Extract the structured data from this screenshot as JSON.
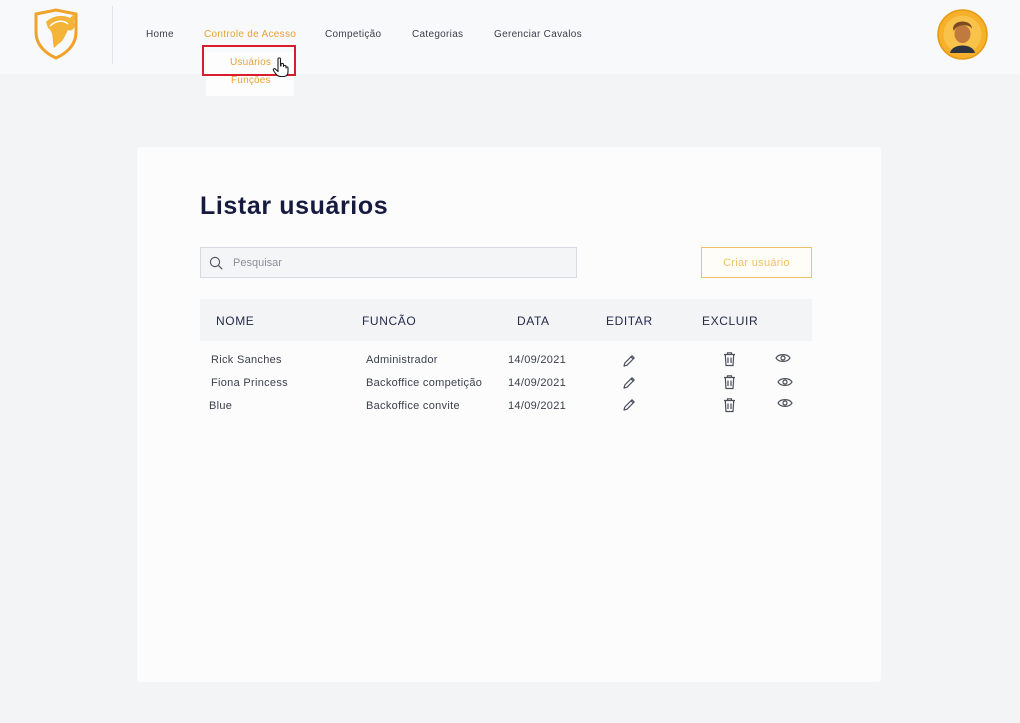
{
  "nav": {
    "items": [
      {
        "label": "Home"
      },
      {
        "label": "Controle de Acesso"
      },
      {
        "label": "Competição"
      },
      {
        "label": "Categorias"
      },
      {
        "label": "Gerenciar Cavalos"
      }
    ],
    "dropdown": [
      {
        "label": "Usuários"
      },
      {
        "label": "Funções"
      }
    ],
    "active_color": "#e8a036"
  },
  "page": {
    "title": "Listar usuários",
    "search_placeholder": "Pesquisar",
    "create_button": "Criar usuário"
  },
  "table": {
    "headers": {
      "name": "NOME",
      "role": "FUNCÃO",
      "date": "DATA",
      "edit": "EDITAR",
      "delete": "EXCLUIR"
    },
    "rows": [
      {
        "name": "Rick Sanches",
        "role": "Administrador",
        "date": "14/09/2021"
      },
      {
        "name": "Fiona Princess",
        "role": "Backoffice competição",
        "date": "14/09/2021"
      },
      {
        "name": "Blue",
        "role": "Backoffice convite",
        "date": "14/09/2021"
      }
    ]
  },
  "icons": {
    "logo": "horse-shield-logo",
    "avatar": "user-avatar",
    "search": "search-icon",
    "edit": "pencil-icon",
    "delete": "trash-icon",
    "view": "eye-icon"
  },
  "colors": {
    "accent": "#e8a036",
    "highlight": "#d81d2c",
    "title": "#161a3f"
  }
}
